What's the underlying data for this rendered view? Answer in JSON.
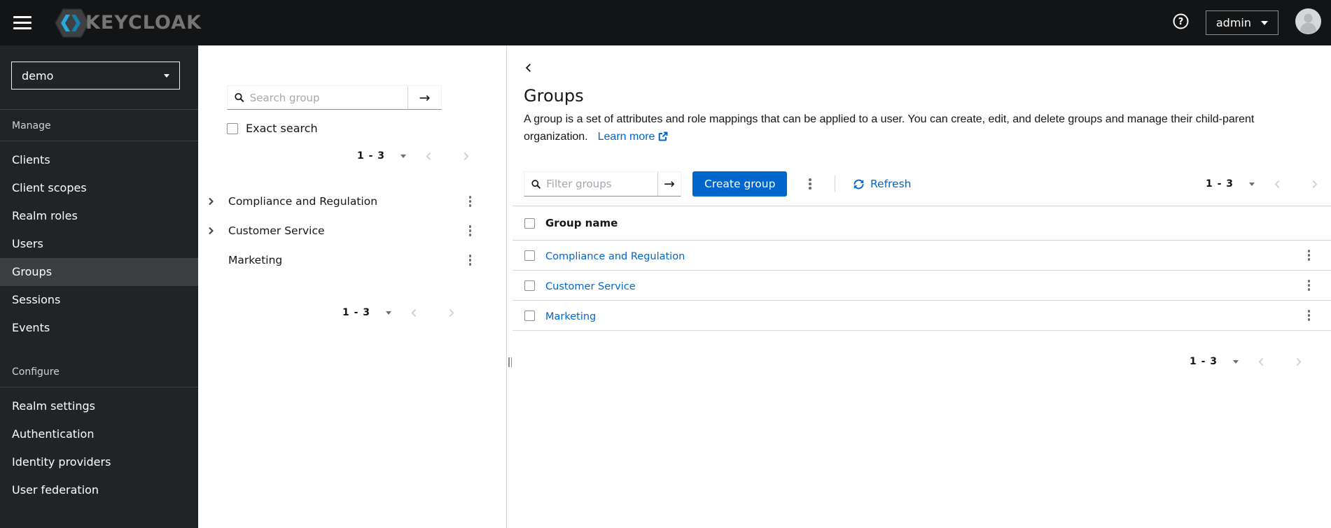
{
  "colors": {
    "accent_blue": "#0066cc",
    "masthead_bg": "#121416",
    "sidebar_bg": "#212427",
    "sidebar_active_bg": "#3c3f42",
    "link_blue": "#0066cc",
    "border_gray": "#d2d2d2"
  },
  "masthead": {
    "logo_text": "KEYCLOAK",
    "username": "admin"
  },
  "sidebar": {
    "realm_selector": {
      "value": "demo"
    },
    "sections": [
      {
        "label": "Manage",
        "items": [
          "Clients",
          "Client scopes",
          "Realm roles",
          "Users",
          "Groups",
          "Sessions",
          "Events"
        ]
      },
      {
        "label": "Configure",
        "items": [
          "Realm settings",
          "Authentication",
          "Identity providers",
          "User federation"
        ]
      }
    ],
    "active_item": "Groups"
  },
  "tree": {
    "search_placeholder": "Search group",
    "exact_search_label": "Exact search",
    "pagination": {
      "range": "1 - 3"
    },
    "items": [
      {
        "name": "Compliance and Regulation",
        "expandable": true
      },
      {
        "name": "Customer Service",
        "expandable": true
      },
      {
        "name": "Marketing",
        "expandable": false
      }
    ]
  },
  "main": {
    "title": "Groups",
    "description": "A group is a set of attributes and role mappings that can be applied to a user. You can create, edit, and delete groups and manage their child-parent organization.",
    "learn_more_label": "Learn more",
    "toolbar": {
      "filter_placeholder": "Filter groups",
      "create_button_label": "Create group",
      "refresh_label": "Refresh"
    },
    "pagination": {
      "range": "1 - 3"
    },
    "table": {
      "column_header": "Group name",
      "rows": [
        {
          "name": "Compliance and Regulation"
        },
        {
          "name": "Customer Service"
        },
        {
          "name": "Marketing"
        }
      ]
    }
  }
}
